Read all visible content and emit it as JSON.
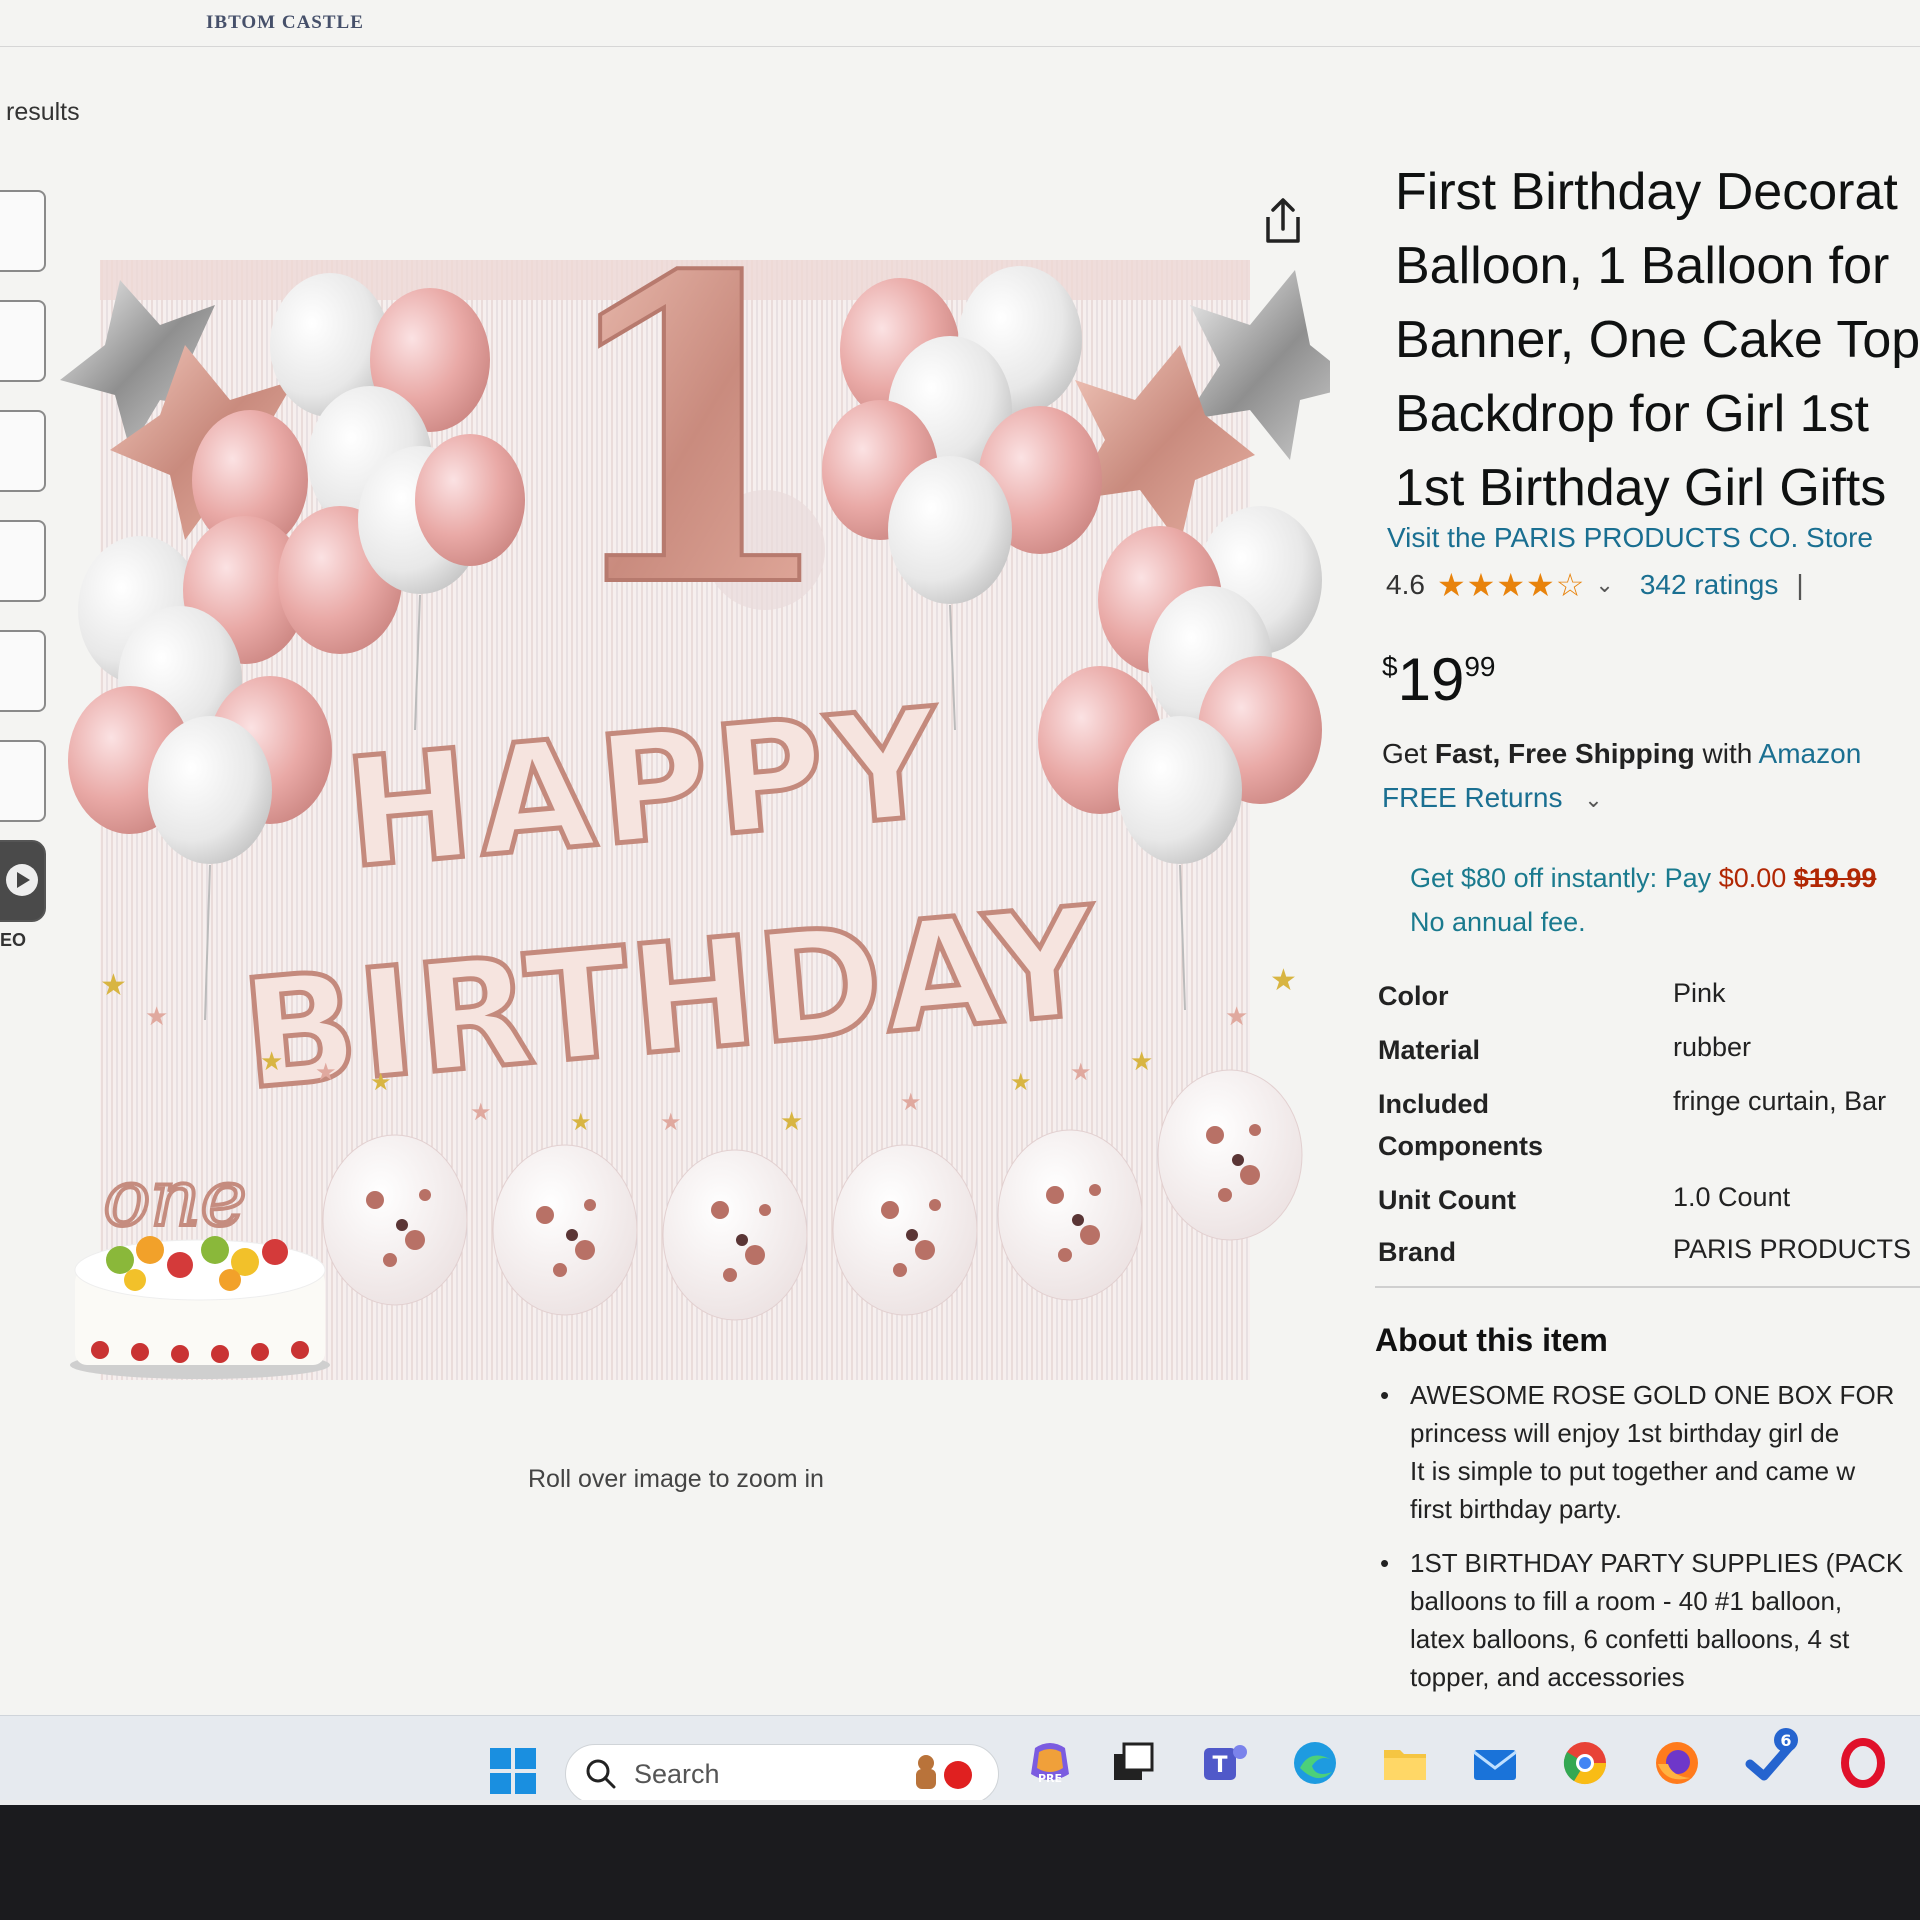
{
  "header": {
    "brand": "IBTOM CASTLE"
  },
  "gallery": {
    "results_text": "results",
    "video_label": "EO",
    "zoom_hint": "Roll over image to zoom in",
    "image": {
      "number_one": "1",
      "happy": "HAPPY",
      "birthday": "BIRTHDAY",
      "cake_topper": "one"
    }
  },
  "product": {
    "title_lines": [
      "First Birthday Decorat",
      "Balloon, 1 Balloon for",
      "Banner, One Cake Top",
      "Backdrop for Girl 1st",
      "1st Birthday Girl Gifts"
    ],
    "store_link": "Visit the PARIS PRODUCTS CO. Store",
    "rating": "4.6",
    "stars": "★★★★☆",
    "ratings_count": "342 ratings",
    "ratings_sep": "|",
    "price": {
      "currency": "$",
      "whole": "19",
      "fraction": "99"
    },
    "shipping": {
      "get": "Get",
      "fast_free": "Fast, Free Shipping",
      "with": "with",
      "amazon": "Amazon",
      "free_returns": "FREE Returns"
    },
    "offer": {
      "line1_pre": "Get $80 off instantly: Pay",
      "pay_amount": "$0.00",
      "orig_amount": "$19.99",
      "line2": "No annual fee."
    },
    "specs": [
      {
        "key": "Color",
        "value": "Pink"
      },
      {
        "key": "Material",
        "value": "rubber"
      },
      {
        "key": "Included Components",
        "value": "fringe curtain, Bar"
      },
      {
        "key": "Unit Count",
        "value": "1.0 Count"
      },
      {
        "key": "Brand",
        "value": "PARIS PRODUCTS"
      }
    ],
    "about_title": "About this item",
    "bullets": [
      {
        "lines": [
          "AWESOME ROSE GOLD ONE BOX FOR",
          "princess will enjoy 1st birthday girl de",
          "It is simple to put together and came w",
          "first birthday party."
        ]
      },
      {
        "lines": [
          "1ST BIRTHDAY PARTY SUPPLIES (PACK",
          "balloons to fill a room - 40 #1 balloon,",
          "latex balloons, 6 confetti balloons, 4 st",
          "topper, and accessories"
        ]
      }
    ]
  },
  "taskbar": {
    "search_label": "Search",
    "copilot_badge": "PRE",
    "teams_letter": "T",
    "todo_badge": "6"
  },
  "colors": {
    "link": "#1a6f91",
    "star": "#e8830c",
    "price_red": "#b12704",
    "rose_gold": "#d9a291"
  }
}
